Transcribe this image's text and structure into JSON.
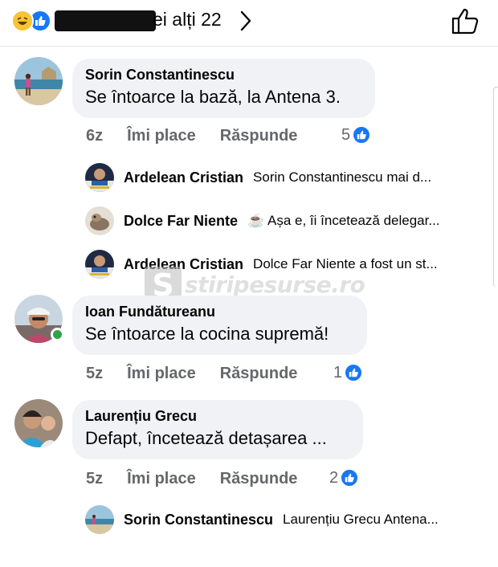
{
  "header": {
    "others_text": "ei alți 22",
    "reaction_icons": [
      "haha-icon",
      "like-icon"
    ]
  },
  "comments": [
    {
      "author": "Sorin Constantinescu",
      "text": "Se întoarce la bază, la Antena 3.",
      "time": "6z",
      "like_label": "Îmi place",
      "reply_label": "Răspunde",
      "reaction_count": "5",
      "replies": [
        {
          "author": "Ardelean Cristian",
          "text": "Sorin Constantinescu mai d..."
        },
        {
          "author": "Dolce Far Niente",
          "text": "☕ Așa e, îi încetează delegar..."
        },
        {
          "author": "Ardelean Cristian",
          "text": "Dolce Far Niente a fost un st..."
        }
      ]
    },
    {
      "author": "Ioan Fundătureanu",
      "text": "Se întoarce la cocina supremă!",
      "time": "5z",
      "like_label": "Îmi place",
      "reply_label": "Răspunde",
      "reaction_count": "1"
    },
    {
      "author": "Laurențiu Grecu",
      "text": "Defapt, încetează detașarea ...",
      "time": "5z",
      "like_label": "Îmi place",
      "reply_label": "Răspunde",
      "reaction_count": "2",
      "replies": [
        {
          "author": "Sorin Constantinescu",
          "text": "Laurențiu Grecu Antena..."
        }
      ]
    }
  ],
  "watermark": {
    "text": "stiripesurse.ro",
    "letter": "S"
  },
  "colors": {
    "accent": "#1877f2",
    "bubble": "#f0f2f5",
    "meta": "#65676b",
    "online": "#31a24c"
  }
}
